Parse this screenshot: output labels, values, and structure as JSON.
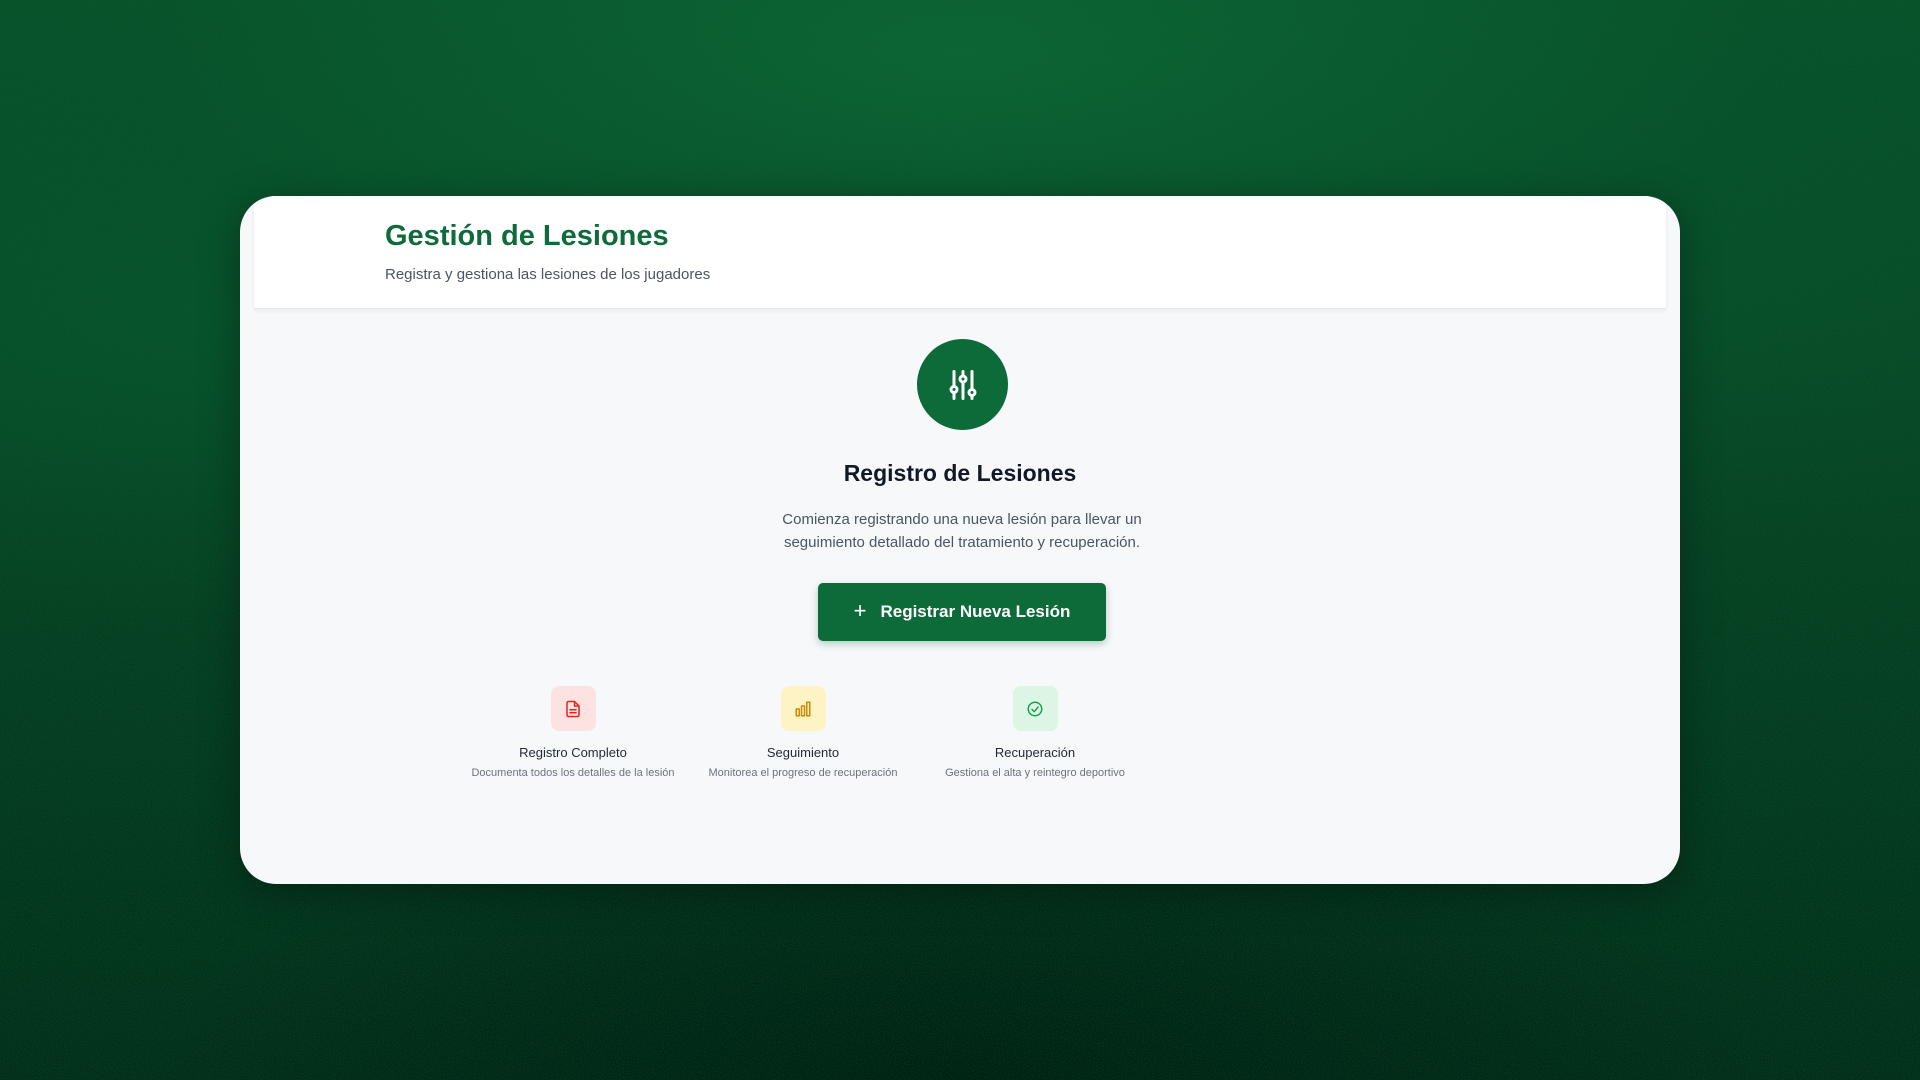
{
  "header": {
    "title": "Gestión de Lesiones",
    "subtitle": "Registra y gestiona las lesiones de los jugadores"
  },
  "hero": {
    "icon": "sliders-icon",
    "title": "Registro de Lesiones",
    "description": "Comienza registrando una nueva lesión para llevar un seguimiento detallado del tratamiento y recuperación."
  },
  "primary_action": {
    "icon": "plus-icon",
    "label": "Registrar Nueva Lesión"
  },
  "features": [
    {
      "icon": "document-icon",
      "title": "Registro Completo",
      "description": "Documenta todos los detalles de la lesión",
      "icon_color": "#dc2626",
      "icon_bg": "#fde2e2"
    },
    {
      "icon": "bar-chart-icon",
      "title": "Seguimiento",
      "description": "Monitorea el progreso de recuperación",
      "icon_color": "#ca8a04",
      "icon_bg": "#fdf3c4"
    },
    {
      "icon": "check-circle-icon",
      "title": "Recuperación",
      "description": "Gestiona el alta y reintegro deportivo",
      "icon_color": "#16a34a",
      "icon_bg": "#dcf5e4"
    }
  ],
  "colors": {
    "brand_green": "#0d6b3a",
    "title_green": "#0f6b3c",
    "panel_bg": "#f7f8fa"
  }
}
